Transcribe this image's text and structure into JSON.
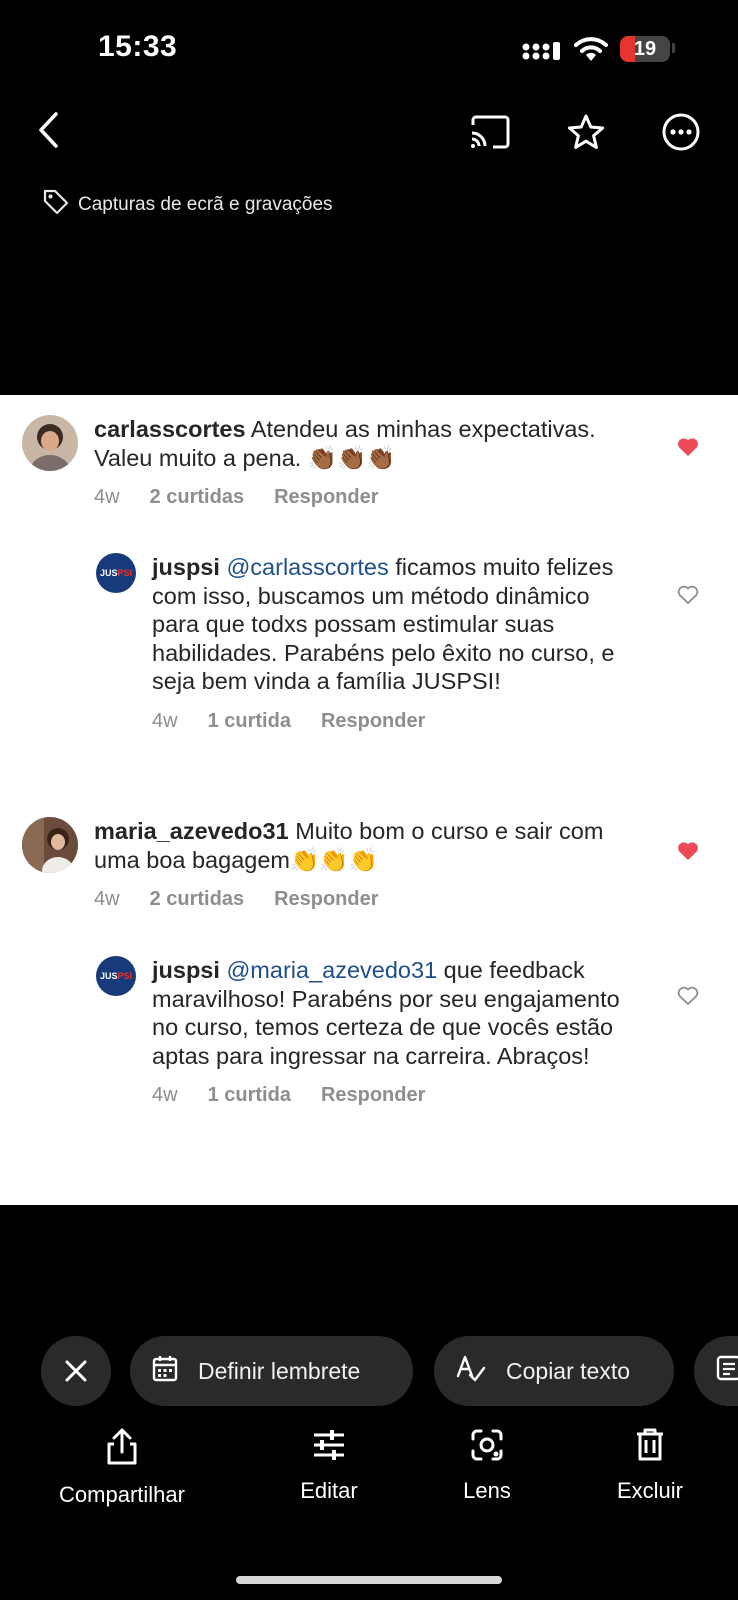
{
  "status": {
    "time": "15:33",
    "battery": "19",
    "battery_level": 0.19
  },
  "toolbar": {
    "back": "back",
    "cast": "cast",
    "favorite": "star",
    "more": "more"
  },
  "album_tag": "Capturas de ecrã e gravações",
  "comments": [
    {
      "user": "carlasscortes",
      "text": "Atendeu as minhas expectativas. Valeu muito a pena. 👏🏾👏🏾👏🏾",
      "age": "4w",
      "likes": "2 curtidas",
      "reply": "Responder",
      "liked": true
    },
    {
      "user": "juspsi",
      "mention": "@carlasscortes",
      "text": "ficamos muito felizes com isso, buscamos um método dinâmico para que todxs possam estimular suas habilidades. Parabéns pelo êxito no curso, e seja bem vinda a família JUSPSI!",
      "age": "4w",
      "likes": "1 curtida",
      "reply": "Responder",
      "liked": false
    },
    {
      "user": "maria_azevedo31",
      "text": "Muito bom o curso e sair com uma boa bagagem👏👏👏",
      "age": "4w",
      "likes": "2 curtidas",
      "reply": "Responder",
      "liked": true
    },
    {
      "user": "juspsi",
      "mention": "@maria_azevedo31",
      "text": "que feedback maravilhoso! Parabéns por seu engajamento no curso, temos certeza de que vocês estão aptas para ingressar na carreira. Abraços!",
      "age": "4w",
      "likes": "1 curtida",
      "reply": "Responder",
      "liked": false
    }
  ],
  "avatar_logo": {
    "a": "JUS",
    "b": "PSI"
  },
  "chips": {
    "remind": "Definir lembrete",
    "copy": "Copiar texto"
  },
  "actions": {
    "share": "Compartilhar",
    "edit": "Editar",
    "lens": "Lens",
    "delete": "Excluir"
  },
  "colors": {
    "heart_liked": "#ed4956",
    "mention": "#1f4f8a",
    "chip_bg": "#2a2a2a"
  }
}
